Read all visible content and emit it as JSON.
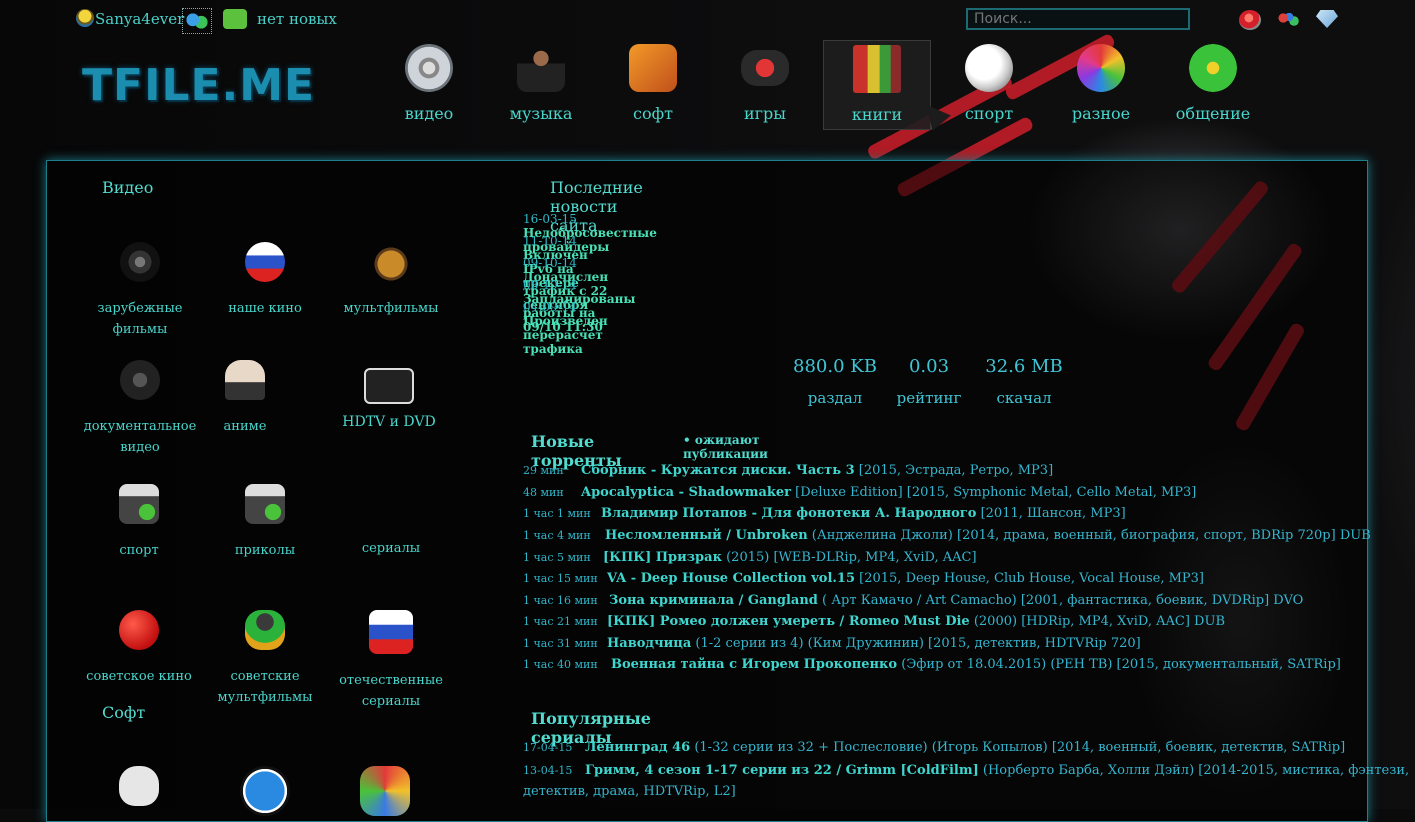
{
  "header": {
    "username": "Sanya4ever",
    "messages": "нет новых",
    "search_placeholder": "Поиск...",
    "logo": "TFILE.ME"
  },
  "categories": [
    {
      "label": "видео",
      "icon": "film-reel-icon"
    },
    {
      "label": "музыка",
      "icon": "musician-icon"
    },
    {
      "label": "софт",
      "icon": "software-box-icon"
    },
    {
      "label": "игры",
      "icon": "gamepad-icon"
    },
    {
      "label": "книги",
      "icon": "books-icon"
    },
    {
      "label": "спорт",
      "icon": "soccer-ball-icon"
    },
    {
      "label": "разное",
      "icon": "color-wheel-icon"
    },
    {
      "label": "общение",
      "icon": "icq-flower-icon"
    }
  ],
  "sidebar": {
    "video_title": "Видео",
    "video_items": [
      {
        "label": "зарубежные фильмы",
        "icon": "film-reel-icon"
      },
      {
        "label": "наше кино",
        "icon": "russia-ball-icon"
      },
      {
        "label": "мультфильмы",
        "icon": "cartoon-creature-icon"
      },
      {
        "label": "документальное видео",
        "icon": "documentary-icon"
      },
      {
        "label": "аниме",
        "icon": "anime-cat-icon"
      },
      {
        "label": "HDTV и DVD",
        "icon": "hd-icon"
      },
      {
        "label": "спорт",
        "icon": "sport-trophy-icon"
      },
      {
        "label": "приколы",
        "icon": "funny-trophy-icon"
      },
      {
        "label": "сериалы",
        "icon": "clapper-serial-icon"
      },
      {
        "label": "советское кино",
        "icon": "ussr-ball-icon"
      },
      {
        "label": "советские мультфильмы",
        "icon": "parrot-icon"
      },
      {
        "label": "отечественные сериалы",
        "icon": "russia-square-icon"
      }
    ],
    "soft_title": "Софт",
    "soft_items": [
      {
        "label": "",
        "icon": "apple-icon"
      },
      {
        "label": "",
        "icon": "programs-icon"
      },
      {
        "label": "",
        "icon": "mascots-icon"
      }
    ]
  },
  "news": {
    "title": "Последние новости сайта",
    "items": [
      {
        "date": "16-03-15",
        "text": "Недобросовестные провайдеры"
      },
      {
        "date": "11-10-14",
        "text": "Включен IPv6 на трекере"
      },
      {
        "date": "09-10-14",
        "text": "Доначислен трафик с 22 сентября"
      },
      {
        "date": "08-10-14",
        "text": "Запланированы работы на 09/10 11:30"
      },
      {
        "date": "04-09-14",
        "text": "Произведен перерасчет трафика"
      }
    ]
  },
  "stats": {
    "upload": "880.0 KB",
    "upload_label": "раздал",
    "rating": "0.03",
    "rating_label": "рейтинг",
    "download": "32.6 MB",
    "download_label": "скачал"
  },
  "torrents": {
    "title": "Новые торренты",
    "pending": "• ожидают публикации",
    "items": [
      {
        "time": "29 мин",
        "title": "Сборник - Кружатся диски. Часть 3",
        "extra": " [2015, Эстрада, Ретро, MP3]"
      },
      {
        "time": "48 мин",
        "title": "Apocalyptica - Shadowmaker",
        "extra": " [Deluxe Edition] [2015, Symphonic Metal, Cello Metal, MP3]"
      },
      {
        "time": "1 час 1 мин",
        "title": "Владимир Потапов - Для фонотеки А. Народного",
        "extra": " [2011, Шансон, MP3]"
      },
      {
        "time": "1 час 4 мин",
        "title": "Несломленный / Unbroken",
        "extra": " (Анджелина Джоли) [2014, драма, военный, биография, спорт, BDRip 720p] DUB"
      },
      {
        "time": "1 час 5 мин",
        "title": "[КПК] Призрак",
        "extra": " (2015) [WEB-DLRip, MP4, XviD, AAC]"
      },
      {
        "time": "1 час 15 мин",
        "title": "VA - Deep House Collection vol.15",
        "extra": " [2015, Deep House, Club House, Vocal House, MP3]"
      },
      {
        "time": "1 час 16 мин",
        "title": "Зона криминала / Gangland",
        "extra": " ( Арт Камачо / Art Camacho) [2001, фантастика, боевик, DVDRip] DVO"
      },
      {
        "time": "1 час 21 мин",
        "title": "[КПК] Ромео должен умереть / Romeo Must Die",
        "extra": " (2000) [HDRip, MP4, XviD, AAC] DUB"
      },
      {
        "time": "1 час 31 мин",
        "title": "Наводчица",
        "extra": " (1-2 серии из 4) (Ким Дружинин) [2015, детектив, HDTVRip 720]"
      },
      {
        "time": "1 час 40 мин",
        "title": "Военная тайна с Игорем Прокопенко",
        "extra": " (Эфир от 18.04.2015) (РЕН ТВ) [2015, документальный, SATRip]"
      }
    ]
  },
  "serials": {
    "title": "Популярные сериалы",
    "items": [
      {
        "date": "17-04-15",
        "title": "Ленинград 46",
        "extra": " (1-32 серии из 32 + Послесловие) (Игорь Копылов) [2014, военный, боевик, детектив, SATRip]"
      },
      {
        "date": "13-04-15",
        "title": "Гримм, 4 сезон 1-17 серии из 22 / Grimm [ColdFilm]",
        "extra": " (Норберто Барба, Холли Дэйл) [2014-2015, мистика, фэнтези,"
      },
      {
        "date": "",
        "title": "",
        "extra": "детектив, драма, HDTVRip, L2]"
      }
    ]
  },
  "colors": {
    "accent": "#49d6cc",
    "panel_border": "#1e7f8a",
    "stripe": "#c21d28"
  }
}
